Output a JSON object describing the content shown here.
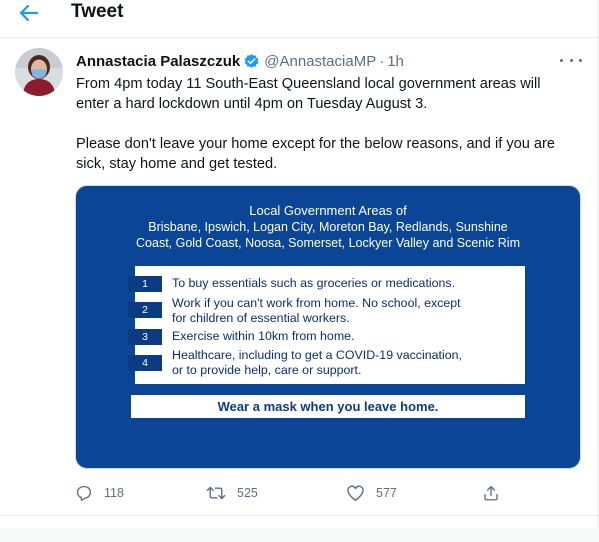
{
  "header": {
    "title": "Tweet",
    "back_icon": "arrow-left-icon",
    "accent_color": "#1d9bf0"
  },
  "tweet": {
    "author_name": "Annastacia Palaszczuk",
    "handle": "@AnnastaciaMP",
    "separator": "·",
    "time": "1h",
    "verified_icon": "verified-badge-icon",
    "verified_color": "#1d9bf0",
    "text_lines": [
      "From 4pm today 11 South-East Queensland local government areas will",
      "enter a hard lockdown until 4pm on Tuesday August 3.",
      "Please don't leave your home except for the below reasons, and if you are",
      "sick, stay home and get tested."
    ]
  },
  "media": {
    "background_color": "#0b4595",
    "title": "Local Government Areas of",
    "lga_lines": [
      "Brisbane, Ipswich, Logan City, Moreton Bay, Redlands, Sunshine",
      "Coast, Gold Coast, Noosa, Somerset, Lockyer Valley and Scenic Rim"
    ],
    "reasons": [
      {
        "num": "1",
        "lines": [
          "To buy essentials such as groceries or medications."
        ]
      },
      {
        "num": "2",
        "lines": [
          "Work if you can't work from home. No school, except",
          "for children of essential workers."
        ]
      },
      {
        "num": "3",
        "lines": [
          "Exercise within 10km from home."
        ]
      },
      {
        "num": "4",
        "lines": [
          "Healthcare, including to get a COVID-19 vaccination,",
          "or to provide help, care or support."
        ]
      }
    ],
    "mask_notice": "Wear a mask when you leave home."
  },
  "actions": {
    "reply": {
      "icon": "reply-icon",
      "count": "118"
    },
    "retweet": {
      "icon": "retweet-icon",
      "count": "525"
    },
    "like": {
      "icon": "heart-icon",
      "count": "577"
    },
    "share": {
      "icon": "share-icon"
    }
  }
}
